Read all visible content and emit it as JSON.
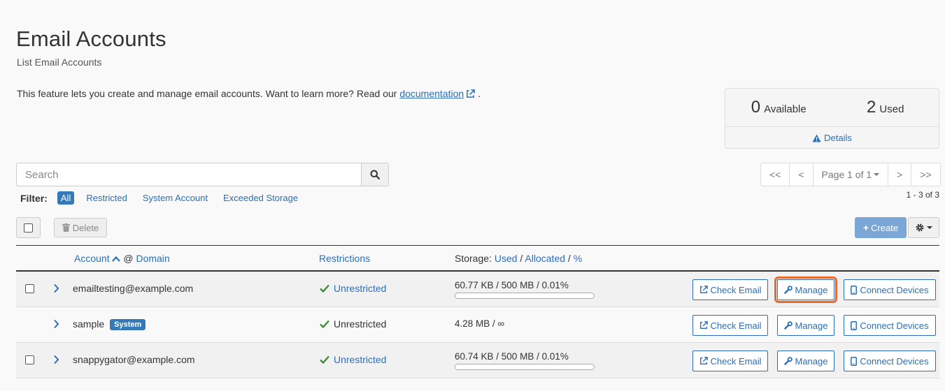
{
  "page": {
    "title": "Email Accounts",
    "subtitle": "List Email Accounts",
    "intro_text": "This feature lets you create and manage email accounts. Want to learn more? Read our ",
    "intro_link": "documentation",
    "intro_end": "."
  },
  "stats": {
    "available_count": "0",
    "available_label": "Available",
    "used_count": "2",
    "used_label": "Used",
    "details_label": "Details"
  },
  "search": {
    "placeholder": "Search",
    "value": ""
  },
  "filter": {
    "label": "Filter:",
    "items": [
      "All",
      "Restricted",
      "System Account",
      "Exceeded Storage"
    ],
    "active": "All"
  },
  "pager": {
    "first": "<<",
    "prev": "<",
    "page_label": "Page 1 of 1",
    "next": ">",
    "last": ">>",
    "range": "1 - 3 of 3"
  },
  "toolbar": {
    "delete_label": "Delete",
    "create_label": "Create"
  },
  "table": {
    "col_account": "Account",
    "col_at": "@",
    "col_domain": "Domain",
    "col_restrictions": "Restrictions",
    "col_storage_prefix": "Storage:",
    "col_used": "Used",
    "col_allocated": "Allocated",
    "col_percent": "%",
    "sep": "/",
    "rows": [
      {
        "account": "emailtesting@example.com",
        "badge": "",
        "restriction": "Unrestricted",
        "storage": "60.77 KB / 500 MB / 0.01%",
        "usage_fraction": 0.0001,
        "has_checkbox": true,
        "has_bar": true,
        "restriction_link": true
      },
      {
        "account": "sample",
        "badge": "System",
        "restriction": "Unrestricted",
        "storage": "4.28 MB / ∞",
        "has_checkbox": false,
        "has_bar": false,
        "restriction_link": false
      },
      {
        "account": "snappygator@example.com",
        "badge": "",
        "restriction": "Unrestricted",
        "storage": "60.74 KB / 500 MB / 0.01%",
        "usage_fraction": 0.0001,
        "has_checkbox": true,
        "has_bar": true,
        "restriction_link": true
      }
    ],
    "actions": {
      "check_email": "Check Email",
      "manage": "Manage",
      "connect_devices": "Connect Devices"
    }
  },
  "colors": {
    "link": "#2a6ebb",
    "primary": "#337ab7",
    "create_disabled": "#7ba7d6",
    "success": "#3c8a3c",
    "highlight": "#e86b2c"
  }
}
